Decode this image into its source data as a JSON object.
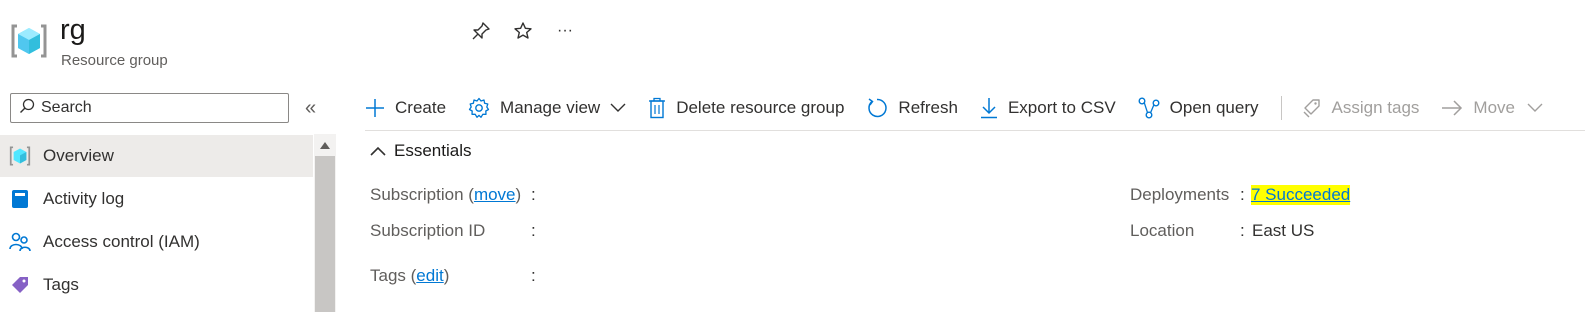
{
  "header": {
    "title": "rg",
    "subtitle": "Resource group",
    "more_label": "···"
  },
  "sidebar": {
    "search": {
      "placeholder": "Search"
    },
    "collapse_label": "«",
    "items": [
      {
        "label": "Overview",
        "icon": "resource-group-icon",
        "active": true
      },
      {
        "label": "Activity log",
        "icon": "activity-log-icon",
        "active": false
      },
      {
        "label": "Access control (IAM)",
        "icon": "people-icon",
        "active": false
      },
      {
        "label": "Tags",
        "icon": "tag-icon",
        "active": false
      }
    ]
  },
  "toolbar": {
    "create": "Create",
    "manage_view": "Manage view",
    "delete": "Delete resource group",
    "refresh": "Refresh",
    "export": "Export to CSV",
    "open_query": "Open query",
    "assign_tags": "Assign tags",
    "move": "Move"
  },
  "essentials": {
    "title": "Essentials",
    "subscription": {
      "label": "Subscription (",
      "link": "move",
      "label_end": ")",
      "colon": ":",
      "value": ""
    },
    "subscription_id": {
      "label": "Subscription ID",
      "colon": ":",
      "value": ""
    },
    "tags": {
      "label": "Tags (",
      "link": "edit",
      "label_end": ")",
      "colon": ":",
      "value": ""
    },
    "deployments": {
      "label": "Deployments",
      "colon": ":",
      "value": "7 Succeeded"
    },
    "location": {
      "label": "Location",
      "colon": ":",
      "value": "East US"
    }
  },
  "colors": {
    "link": "#0078d4",
    "highlight": "#ffff00",
    "active_nav": "#edebe9",
    "icon_blue": "#0078d4",
    "tag_purple": "#8661c5"
  }
}
